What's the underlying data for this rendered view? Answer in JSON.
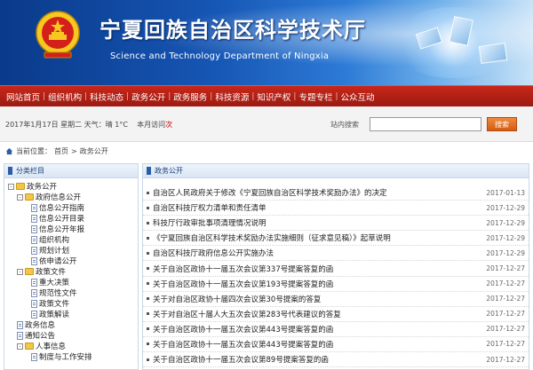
{
  "header": {
    "title": "宁夏回族自治区科学技术厅",
    "subtitle": "Science and Technology Department of Ningxia"
  },
  "nav": {
    "items": [
      "网站首页",
      "组织机构",
      "科技动态",
      "政务公开",
      "政务服务",
      "科技资源",
      "知识产权",
      "专题专栏",
      "公众互动"
    ]
  },
  "infobar": {
    "date": "2017年1月17日 星期二",
    "weather": "天气：晴 1°C",
    "welcome_prefix": "本月访问",
    "welcome_count": "次",
    "search_label": "站内搜索",
    "search_placeholder": "",
    "search_button": "搜索"
  },
  "breadcrumb": {
    "prefix": "当前位置：",
    "home": "首页",
    "sep": "> ",
    "current": "政务公开"
  },
  "sidebar": {
    "title": "分类栏目",
    "tree": [
      {
        "level": 1,
        "toggle": "-",
        "icon": "folder",
        "label": "政务公开"
      },
      {
        "level": 2,
        "toggle": "-",
        "icon": "folder",
        "label": "政府信息公开"
      },
      {
        "level": 3,
        "toggle": "",
        "icon": "doc",
        "label": "信息公开指南"
      },
      {
        "level": 3,
        "toggle": "",
        "icon": "doc",
        "label": "信息公开目录"
      },
      {
        "level": 3,
        "toggle": "",
        "icon": "doc",
        "label": "信息公开年报"
      },
      {
        "level": 3,
        "toggle": "",
        "icon": "doc",
        "label": "组织机构"
      },
      {
        "level": 3,
        "toggle": "",
        "icon": "doc",
        "label": "规划计划"
      },
      {
        "level": 3,
        "toggle": "",
        "icon": "doc",
        "label": "依申请公开"
      },
      {
        "level": 2,
        "toggle": "-",
        "icon": "folder",
        "label": "政策文件"
      },
      {
        "level": 3,
        "toggle": "",
        "icon": "doc",
        "label": "重大决策"
      },
      {
        "level": 3,
        "toggle": "",
        "icon": "doc",
        "label": "规范性文件"
      },
      {
        "level": 3,
        "toggle": "",
        "icon": "doc",
        "label": "政策文件"
      },
      {
        "level": 3,
        "toggle": "",
        "icon": "doc",
        "label": "政策解读"
      },
      {
        "level": 2,
        "toggle": "",
        "icon": "doc",
        "label": "政务信息"
      },
      {
        "level": 2,
        "toggle": "",
        "icon": "doc",
        "label": "通知公告"
      },
      {
        "level": 2,
        "toggle": "-",
        "icon": "folder",
        "label": "人事信息"
      },
      {
        "level": 3,
        "toggle": "",
        "icon": "doc",
        "label": "制度与工作安排"
      }
    ]
  },
  "main": {
    "title": "政务公开",
    "rows": [
      {
        "title": "自治区人民政府关于修改《宁夏回族自治区科学技术奖励办法》的决定",
        "date": "2017-01-13"
      },
      {
        "title": "自治区科技厅权力清单和责任清单",
        "date": "2017-12-29"
      },
      {
        "title": "科技厅行政审批事项清理情况说明",
        "date": "2017-12-29"
      },
      {
        "title": "《宁夏回族自治区科学技术奖励办法实施细则（征求意见稿）》起草说明",
        "date": "2017-12-29"
      },
      {
        "title": "自治区科技厅政府信息公开实施办法",
        "date": "2017-12-29"
      },
      {
        "title": "关于自治区政协十一届五次会议第337号提案答复的函",
        "date": "2017-12-27"
      },
      {
        "title": "关于自治区政协十一届五次会议第193号提案答复的函",
        "date": "2017-12-27"
      },
      {
        "title": "关于对自治区政协十届四次会议第30号提案的答复",
        "date": "2017-12-27"
      },
      {
        "title": "关于对自治区十届人大五次会议第283号代表建议的答复",
        "date": "2017-12-27"
      },
      {
        "title": "关于自治区政协十一届五次会议第443号提案答复的函",
        "date": "2017-12-27"
      },
      {
        "title": "关于自治区政协十一届五次会议第443号提案答复的函",
        "date": "2017-12-27"
      },
      {
        "title": "关于自治区政协十一届五次会议第89号提案答复的函",
        "date": "2017-12-27"
      }
    ]
  }
}
